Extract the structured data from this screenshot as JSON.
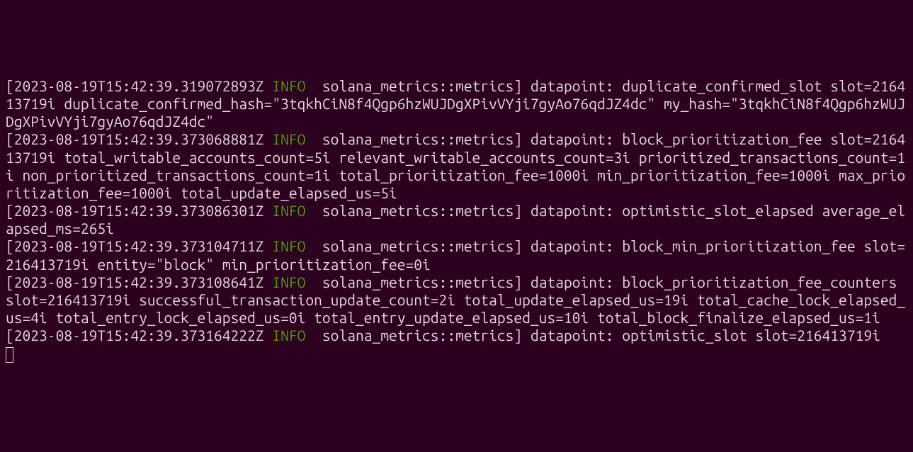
{
  "logs": [
    {
      "timestamp": "2023-08-19T15:42:39.319072893Z",
      "level": "INFO",
      "source": "solana_metrics::metrics",
      "message": "datapoint: duplicate_confirmed_slot slot=216413719i duplicate_confirmed_hash=\"3tqkhCiN8f4Qgp6hzWUJDgXPivVYji7gyAo76qdJZ4dc\" my_hash=\"3tqkhCiN8f4Qgp6hzWUJDgXPivVYji7gyAo76qdJZ4dc\""
    },
    {
      "timestamp": "2023-08-19T15:42:39.373068881Z",
      "level": "INFO",
      "source": "solana_metrics::metrics",
      "message": "datapoint: block_prioritization_fee slot=216413719i total_writable_accounts_count=5i relevant_writable_accounts_count=3i prioritized_transactions_count=1i non_prioritized_transactions_count=1i total_prioritization_fee=1000i min_prioritization_fee=1000i max_prioritization_fee=1000i total_update_elapsed_us=5i"
    },
    {
      "timestamp": "2023-08-19T15:42:39.373086301Z",
      "level": "INFO",
      "source": "solana_metrics::metrics",
      "message": "datapoint: optimistic_slot_elapsed average_elapsed_ms=265i"
    },
    {
      "timestamp": "2023-08-19T15:42:39.373104711Z",
      "level": "INFO",
      "source": "solana_metrics::metrics",
      "message": "datapoint: block_min_prioritization_fee slot=216413719i entity=\"block\" min_prioritization_fee=0i"
    },
    {
      "timestamp": "2023-08-19T15:42:39.373108641Z",
      "level": "INFO",
      "source": "solana_metrics::metrics",
      "message": "datapoint: block_prioritization_fee_counters slot=216413719i successful_transaction_update_count=2i total_update_elapsed_us=19i total_cache_lock_elapsed_us=4i total_entry_lock_elapsed_us=0i total_entry_update_elapsed_us=10i total_block_finalize_elapsed_us=1i"
    },
    {
      "timestamp": "2023-08-19T15:42:39.373164222Z",
      "level": "INFO",
      "source": "solana_metrics::metrics",
      "message": "datapoint: optimistic_slot slot=216413719i"
    }
  ]
}
